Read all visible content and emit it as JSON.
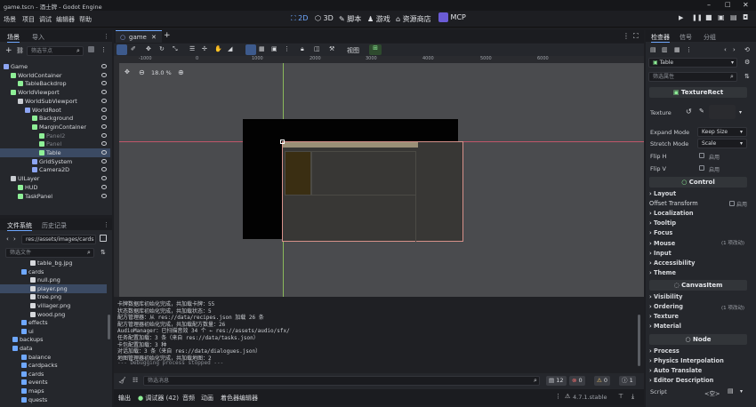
{
  "window": {
    "title": "game.tscn - 酒士牌 - Godot Engine"
  },
  "menu": [
    "场景",
    "项目",
    "调试",
    "编辑器",
    "帮助"
  ],
  "workspaces": [
    {
      "label": "2D",
      "icon": "2d-icon",
      "active": true
    },
    {
      "label": "3D",
      "icon": "3d-icon",
      "active": false
    },
    {
      "label": "脚本",
      "icon": "script-icon",
      "active": false
    },
    {
      "label": "游戏",
      "icon": "game-icon",
      "active": false
    },
    {
      "label": "资源商店",
      "icon": "asset-store-icon",
      "active": false
    },
    {
      "label": "MCP",
      "icon": "mcp-icon",
      "active": false
    }
  ],
  "scene_dock": {
    "tabs": [
      "场景",
      "导入"
    ],
    "filter_placeholder": "筛选节点",
    "nodes": [
      {
        "label": "Game",
        "depth": 0,
        "color": "#8da5f3",
        "dim": false
      },
      {
        "label": "WorldContainer",
        "depth": 1,
        "color": "#8eef97",
        "dim": false
      },
      {
        "label": "TableBackdrop",
        "depth": 2,
        "color": "#8eef97",
        "dim": false
      },
      {
        "label": "WorldViewport",
        "depth": 1,
        "color": "#8eef97",
        "dim": false
      },
      {
        "label": "WorldSubViewport",
        "depth": 2,
        "color": "#c9ccd1",
        "dim": false
      },
      {
        "label": "WorldRoot",
        "depth": 3,
        "color": "#8da5f3",
        "dim": false
      },
      {
        "label": "Background",
        "depth": 4,
        "color": "#8eef97",
        "dim": false
      },
      {
        "label": "MarginContainer",
        "depth": 4,
        "color": "#8eef97",
        "dim": false
      },
      {
        "label": "Panel2",
        "depth": 5,
        "color": "#8eef97",
        "dim": true
      },
      {
        "label": "Panel",
        "depth": 5,
        "color": "#8eef97",
        "dim": true
      },
      {
        "label": "Table",
        "depth": 5,
        "color": "#8eef97",
        "dim": false,
        "selected": true
      },
      {
        "label": "GridSystem",
        "depth": 4,
        "color": "#8da5f3",
        "dim": false
      },
      {
        "label": "Camera2D",
        "depth": 4,
        "color": "#8da5f3",
        "dim": false
      },
      {
        "label": "UILayer",
        "depth": 1,
        "color": "#c9ccd1",
        "dim": false
      },
      {
        "label": "HUD",
        "depth": 2,
        "color": "#8eef97",
        "dim": false
      },
      {
        "label": "TaskPanel",
        "depth": 2,
        "color": "#8eef97",
        "dim": false
      }
    ]
  },
  "fs_dock": {
    "tabs": [
      "文件系统",
      "历史记录"
    ],
    "path": "res://assets/images/cards",
    "filter_placeholder": "筛选文件",
    "items": [
      {
        "label": "table_bg.jpg",
        "depth": 3,
        "type": "file"
      },
      {
        "label": "cards",
        "depth": 2,
        "type": "folder"
      },
      {
        "label": "null.png",
        "depth": 3,
        "type": "file"
      },
      {
        "label": "player.png",
        "depth": 3,
        "type": "file",
        "selected": true
      },
      {
        "label": "tree.png",
        "depth": 3,
        "type": "file"
      },
      {
        "label": "villager.png",
        "depth": 3,
        "type": "file"
      },
      {
        "label": "wood.png",
        "depth": 3,
        "type": "file"
      },
      {
        "label": "effects",
        "depth": 2,
        "type": "folder"
      },
      {
        "label": "ui",
        "depth": 2,
        "type": "folder"
      },
      {
        "label": "backups",
        "depth": 1,
        "type": "folder"
      },
      {
        "label": "data",
        "depth": 1,
        "type": "folder"
      },
      {
        "label": "balance",
        "depth": 2,
        "type": "folder"
      },
      {
        "label": "cardpacks",
        "depth": 2,
        "type": "folder"
      },
      {
        "label": "cards",
        "depth": 2,
        "type": "folder"
      },
      {
        "label": "events",
        "depth": 2,
        "type": "folder"
      },
      {
        "label": "maps",
        "depth": 2,
        "type": "folder"
      },
      {
        "label": "quests",
        "depth": 2,
        "type": "folder"
      }
    ]
  },
  "scene_tab": {
    "label": "game",
    "add": "+"
  },
  "toolbar2d": {
    "view_label": "视图"
  },
  "viewport": {
    "zoom": "18.0 %"
  },
  "ruler": {
    "ticks": [
      "-1000",
      "0",
      "1000",
      "2000",
      "3000",
      "4000",
      "5000",
      "6000"
    ]
  },
  "output": {
    "lines": [
      "卡牌数据库初始化完成，共加载卡牌：55",
      "状态数据库初始化完成，共加载状态：5",
      "配方管理器：从 res://data/recipes.json 加载 26 条",
      "配方管理器初始化完成，共加载配方数量：26",
      "AudioManager：已扫描音效 34 个 ← res://assets/audio/sfx/",
      "任务配置加载：3 条（来自 res://data/tasks.json）",
      "卡包配置加载：3 种",
      "对话加载：3 条（来自 res://data/dialogues.json）",
      "地图管理器初始化完成，共加载地图：2",
      "--- Debugging process stopped ---"
    ],
    "filter_placeholder": "筛选消息",
    "counts": {
      "messages": "12",
      "errors": "0",
      "warnings": "0",
      "info": "1"
    }
  },
  "bottom_tabs": [
    "输出",
    "调试器 (42)",
    "音频",
    "动画",
    "着色器编辑器"
  ],
  "version": "4.7.1.stable",
  "inspector": {
    "tabs": [
      "检查器",
      "信号",
      "分组"
    ],
    "node_name": "Table",
    "filter_placeholder": "筛选属性",
    "class_name": "TextureRect",
    "texture_label": "Texture",
    "expand_mode": {
      "label": "Expand Mode",
      "value": "Keep Size"
    },
    "stretch_mode": {
      "label": "Stretch Mode",
      "value": "Scale"
    },
    "flip_h": {
      "label": "Flip H",
      "value": "启用"
    },
    "flip_v": {
      "label": "Flip V",
      "value": "启用"
    },
    "control_header": "Control",
    "control_sections": [
      "Layout",
      "Offset Transform",
      "Localization",
      "Tooltip",
      "Focus",
      "Mouse",
      "Input",
      "Accessibility",
      "Theme"
    ],
    "offset_enable": "启用",
    "mouse_note": "(1 项改动)",
    "canvas_header": "CanvasItem",
    "canvas_sections": [
      "Visibility",
      "Ordering",
      "Texture",
      "Material"
    ],
    "ordering_note": "(1 项改动)",
    "node_header": "Node",
    "node_sections": [
      "Process",
      "Physics Interpolation",
      "Auto Translate",
      "Editor Description"
    ],
    "script_label": "Script",
    "script_value": "<空>"
  }
}
